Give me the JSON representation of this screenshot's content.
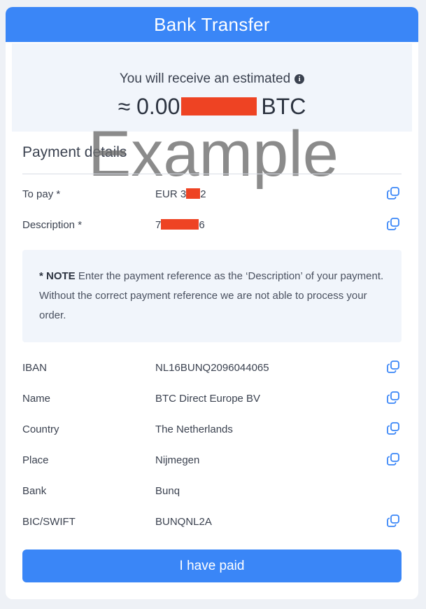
{
  "header": {
    "title": "Bank Transfer"
  },
  "estimate": {
    "label": "You will receive an estimated",
    "amount_prefix": "≈ 0.00",
    "currency": "BTC"
  },
  "watermark": "Example",
  "payment": {
    "title": "Payment details",
    "to_pay": {
      "label": "To pay *",
      "value_start": "EUR 3",
      "value_end": "2"
    },
    "description": {
      "label": "Description *",
      "value_start": "7",
      "value_end": "6"
    }
  },
  "note": {
    "bold": "* NOTE",
    "text": "Enter the payment reference as the ‘Description’ of your payment. Without the correct payment reference we are not able to process your order."
  },
  "bank_details": [
    {
      "label": "IBAN",
      "value": "NL16BUNQ2096044065",
      "copy": true
    },
    {
      "label": "Name",
      "value": "BTC Direct Europe BV",
      "copy": true
    },
    {
      "label": "Country",
      "value": "The Netherlands",
      "copy": true
    },
    {
      "label": "Place",
      "value": "Nijmegen",
      "copy": true
    },
    {
      "label": "Bank",
      "value": "Bunq",
      "copy": false
    },
    {
      "label": "BIC/SWIFT",
      "value": "BUNQNL2A",
      "copy": true
    }
  ],
  "actions": {
    "paid_label": "I have paid"
  },
  "colors": {
    "accent": "#3a86f7",
    "redaction": "#ee4323",
    "panel": "#f1f5fb",
    "text": "#3b4250"
  },
  "icons": {
    "info": "info-circle-icon",
    "copy": "copy-icon"
  }
}
